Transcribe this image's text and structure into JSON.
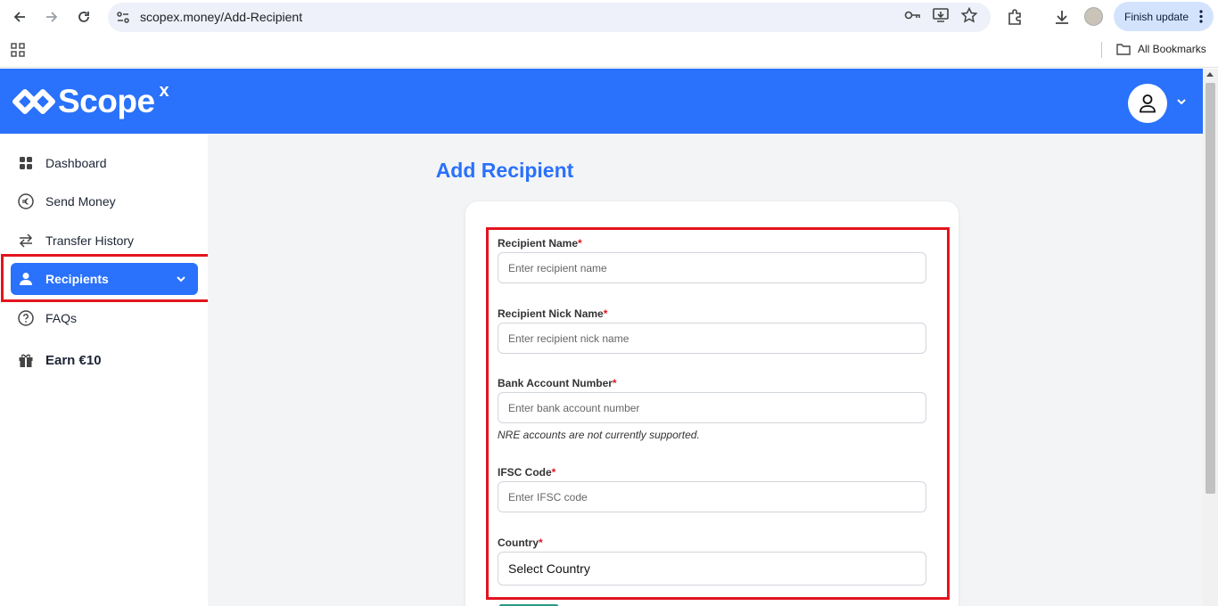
{
  "browser": {
    "url": "scopex.money/Add-Recipient",
    "finish_update_label": "Finish update",
    "bookmarks_label": "All Bookmarks"
  },
  "app": {
    "brand": "Scope",
    "brand_sup": "x",
    "accent_color": "#2a71fb"
  },
  "sidebar": {
    "items": [
      {
        "label": "Dashboard",
        "icon": "grid-icon"
      },
      {
        "label": "Send Money",
        "icon": "euro-icon"
      },
      {
        "label": "Transfer History",
        "icon": "swap-arrows-icon"
      },
      {
        "label": "Recipients",
        "icon": "user-icon",
        "active": true
      },
      {
        "label": "FAQs",
        "icon": "help-circle-icon"
      },
      {
        "label": "Earn €10",
        "icon": "gift-icon"
      }
    ]
  },
  "page": {
    "title": "Add Recipient"
  },
  "form": {
    "name_label": "Recipient Name",
    "name_placeholder": "Enter recipient name",
    "nick_label": "Recipient Nick Name",
    "nick_placeholder": "Enter recipient nick name",
    "account_label": "Bank Account Number",
    "account_placeholder": "Enter bank account number",
    "account_note": "NRE accounts are not currently supported.",
    "ifsc_label": "IFSC Code",
    "ifsc_placeholder": "Enter IFSC code",
    "country_label": "Country",
    "country_value": "Select Country",
    "required_mark": "*"
  }
}
